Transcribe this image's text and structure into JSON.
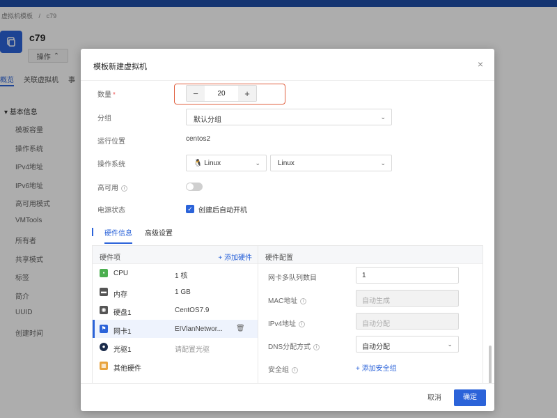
{
  "background": {
    "breadcrumb": [
      "虚拟机模板",
      "/",
      "c79"
    ],
    "vm_name": "c79",
    "ops_label": "操作",
    "tabs": [
      "概览",
      "关联虚拟机",
      "事"
    ],
    "section_title": "基本信息",
    "fields": [
      "模板容量",
      "操作系统",
      "IPv4地址",
      "IPv6地址",
      "高可用模式",
      "VMTools",
      "所有者",
      "共享模式",
      "标签",
      "简介",
      "UUID",
      "创建时间"
    ]
  },
  "modal": {
    "title": "模板新建虚拟机",
    "close_glyph": "×",
    "quantity": {
      "label": "数量",
      "required_mark": "*",
      "value": "20",
      "minus": "−",
      "plus": "+"
    },
    "group": {
      "label": "分组",
      "value": "默认分组"
    },
    "location": {
      "label": "运行位置",
      "value": "centos2"
    },
    "os": {
      "label": "操作系统",
      "type": "Linux",
      "version": "Linux"
    },
    "ha": {
      "label": "高可用"
    },
    "power": {
      "label": "电源状态",
      "checkbox_label": "创建后自动开机"
    },
    "tabs": [
      "硬件信息",
      "高级设置"
    ],
    "hardware": {
      "list_header": "硬件项",
      "add_label": "+ 添加硬件",
      "items": [
        {
          "name": "CPU",
          "value": "1 核",
          "icon": "cpu-icon",
          "color": "#4caf50"
        },
        {
          "name": "内存",
          "value": "1 GB",
          "icon": "memory-icon",
          "color": "#555555"
        },
        {
          "name": "硬盘1",
          "value": "CentOS7.9",
          "icon": "disk-icon",
          "color": "#555555"
        },
        {
          "name": "网卡1",
          "value": "EIVlanNetwor...",
          "icon": "nic-icon",
          "color": "#2b63d9"
        },
        {
          "name": "光驱1",
          "value": "请配置光驱",
          "icon": "cdrom-icon",
          "color": "#1a2b4a"
        },
        {
          "name": "其他硬件",
          "value": "",
          "icon": "toolbox-icon",
          "color": "#e8a33d"
        }
      ],
      "config_header": "硬件配置",
      "config": {
        "queue_label": "网卡多队列数目",
        "queue_value": "1",
        "mac_label": "MAC地址",
        "mac_placeholder": "自动生成",
        "ipv4_label": "IPv4地址",
        "ipv4_placeholder": "自动分配",
        "dns_label": "DNS分配方式",
        "dns_value": "自动分配",
        "sg_label": "安全组",
        "sg_add": "+ 添加安全组"
      }
    },
    "footer": {
      "cancel": "取消",
      "ok": "确定"
    }
  }
}
